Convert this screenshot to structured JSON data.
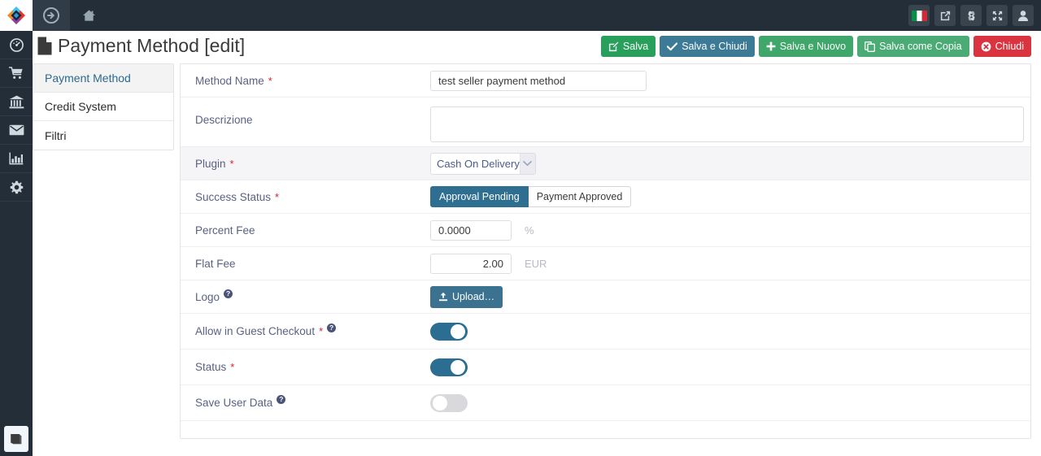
{
  "topbar": {
    "logo_icon": "hikashop-diamond-logo",
    "forward_icon": "arrow-circle-right-icon",
    "home_icon": "home-icon",
    "right_icons": [
      {
        "name": "language-flag-italy-icon",
        "label": "Italiano"
      },
      {
        "name": "external-link-icon",
        "label": "Visualizza sito"
      },
      {
        "name": "joomla-logo-icon",
        "label": "Joomla"
      },
      {
        "name": "expand-arrows-icon",
        "label": "Schermo intero"
      },
      {
        "name": "user-icon",
        "label": "Utente"
      }
    ]
  },
  "rail": {
    "items": [
      {
        "name": "dashboard-icon",
        "label": "Dashboard"
      },
      {
        "name": "shopping-cart-icon",
        "label": "Prodotti"
      },
      {
        "name": "bank-icon",
        "label": "Ordini"
      },
      {
        "name": "envelope-icon",
        "label": "Messaggi"
      },
      {
        "name": "bar-chart-icon",
        "label": "Statistiche"
      },
      {
        "name": "gear-icon",
        "label": "Configurazione"
      }
    ],
    "bottom": {
      "name": "book-icon",
      "label": "Documentazione"
    }
  },
  "header": {
    "title": "Payment Method [edit]",
    "title_icon": "file-document-icon"
  },
  "toolbar": {
    "buttons": [
      {
        "label": "Salva",
        "icon": "pencil-square-icon",
        "style": "green"
      },
      {
        "label": "Salva e Chiudi",
        "icon": "check-icon",
        "style": "blue"
      },
      {
        "label": "Salva e Nuovo",
        "icon": "plus-icon",
        "style": "green2"
      },
      {
        "label": "Salva come Copia",
        "icon": "copy-icon",
        "style": "green3"
      },
      {
        "label": "Chiudi",
        "icon": "times-circle-icon",
        "style": "red"
      }
    ]
  },
  "submenu": {
    "items": [
      {
        "label": "Payment Method",
        "active": true
      },
      {
        "label": "Credit System",
        "active": false
      },
      {
        "label": "Filtri",
        "active": false
      }
    ]
  },
  "form": {
    "method_name": {
      "label": "Method Name",
      "required": true,
      "value": "test seller payment method",
      "placeholder": ""
    },
    "descrizione": {
      "label": "Descrizione",
      "required": false,
      "value": "",
      "placeholder": ""
    },
    "plugin": {
      "label": "Plugin",
      "required": true,
      "selected": "Cash On Delivery",
      "arrow_icon": "chevron-down-icon"
    },
    "success_status": {
      "label": "Success Status",
      "required": true,
      "options": [
        {
          "label": "Approval Pending",
          "selected": true
        },
        {
          "label": "Payment Approved",
          "selected": false
        }
      ]
    },
    "percent_fee": {
      "label": "Percent Fee",
      "required": false,
      "value": "0.0000",
      "unit": "%"
    },
    "flat_fee": {
      "label": "Flat Fee",
      "required": false,
      "value": "2.00",
      "unit": "EUR"
    },
    "logo": {
      "label": "Logo",
      "help": true,
      "button_label": "Upload…",
      "button_icon": "upload-icon"
    },
    "allow_guest_checkout": {
      "label": "Allow in Guest Checkout",
      "required": true,
      "help": true,
      "state": "on"
    },
    "status": {
      "label": "Status",
      "required": true,
      "help": false,
      "state": "on"
    },
    "save_user_data": {
      "label": "Save User Data",
      "required": false,
      "help": true,
      "state": "off"
    }
  },
  "colors": {
    "topbar_bg": "#242e38",
    "accent_blue": "#2d6e91",
    "save_green": "#28a05c",
    "close_red": "#d9343f",
    "label_text": "#5b6180",
    "required_red": "#d9202e",
    "toggle_on": "#2c6d92",
    "toggle_off": "#d9d9dd"
  }
}
